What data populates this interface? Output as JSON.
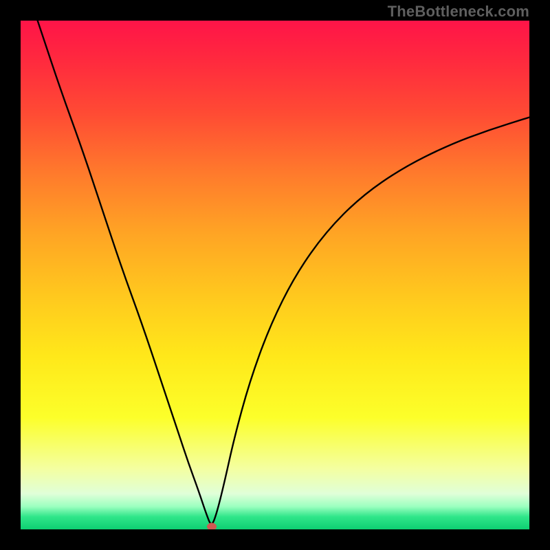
{
  "watermark": "TheBottleneck.com",
  "colors": {
    "top": "#ff1448",
    "mid": "#ffe81a",
    "bottom": "#0ecf72",
    "frame": "#000000",
    "curve": "#000000",
    "marker": "#cf5a52"
  },
  "chart_data": {
    "type": "line",
    "title": "",
    "xlabel": "",
    "ylabel": "",
    "xlim": [
      0,
      100
    ],
    "ylim": [
      0,
      100
    ],
    "grid": false,
    "legend_position": "none",
    "annotations": [
      {
        "text": "TheBottleneck.com",
        "position": "top-right"
      }
    ],
    "marker": {
      "x": 37.5,
      "y": 0.5
    },
    "series": [
      {
        "name": "bottleneck-curve",
        "x": [
          0,
          4,
          8,
          12,
          16,
          20,
          24,
          28,
          31,
          33,
          35,
          36.5,
          37.5,
          38.5,
          40,
          42,
          45,
          49,
          54,
          60,
          67,
          75,
          84,
          92,
          100
        ],
        "y": [
          110,
          98,
          86,
          75,
          63,
          51,
          40,
          28,
          19,
          13,
          7.5,
          3,
          0.5,
          3,
          9,
          18,
          29,
          40,
          50,
          58.5,
          65.5,
          71,
          75.5,
          78.5,
          81
        ]
      }
    ]
  }
}
